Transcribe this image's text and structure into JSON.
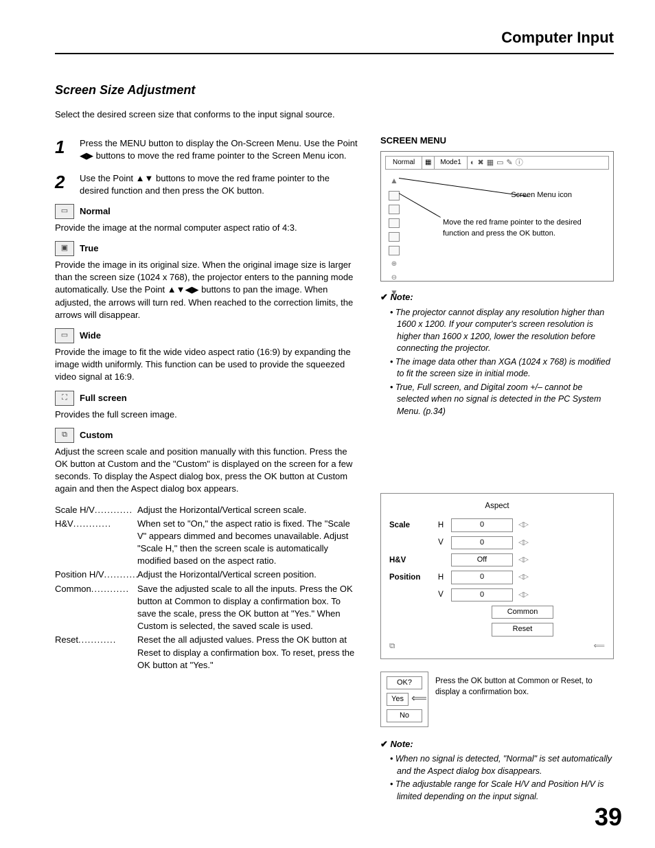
{
  "header": {
    "title": "Computer Input"
  },
  "section": {
    "title": "Screen Size Adjustment"
  },
  "intro": "Select the desired screen size that conforms to the input signal source.",
  "steps": {
    "s1n": "1",
    "s1": "Press the MENU button to display the On-Screen Menu. Use the Point ◀▶ buttons to move the red frame pointer to the Screen Menu icon.",
    "s2n": "2",
    "s2": "Use the Point ▲▼ buttons to move the red frame pointer to the desired function and then press the OK button."
  },
  "features": {
    "normal": {
      "label": "Normal",
      "desc": "Provide the image at the normal computer aspect ratio of 4:3."
    },
    "true": {
      "label": "True",
      "desc": "Provide the image in its original size. When the original image size is larger than the screen size (1024 x 768), the projector enters to the panning mode automatically. Use the Point ▲▼◀▶ buttons to pan the image. When adjusted, the arrows will turn red. When reached to the correction limits, the arrows will disappear."
    },
    "wide": {
      "label": "Wide",
      "desc": "Provide the image to fit the wide video aspect ratio (16:9) by expanding the image width uniformly. This function can be used to provide the squeezed video signal at 16:9."
    },
    "full": {
      "label": "Full screen",
      "desc": "Provides the full screen image."
    },
    "custom": {
      "label": "Custom",
      "desc": "Adjust the screen scale and position manually with this function. Press the OK button at Custom and the \"Custom\" is displayed on the screen for a few seconds. To display the Aspect dialog box, press the OK button at Custom again and then the Aspect dialog box appears."
    }
  },
  "defs": {
    "d1t": "Scale H/V",
    "d1": "Adjust the Horizontal/Vertical screen scale.",
    "d2t": "H&V",
    "d2": "When set to \"On,\" the aspect ratio is fixed. The \"Scale V\" appears dimmed and becomes unavailable. Adjust \"Scale H,\" then the screen scale is automatically modified based on the aspect ratio.",
    "d3t": "Position H/V",
    "d3": "Adjust the Horizontal/Vertical screen position.",
    "d4t": "Common",
    "d4": "Save the adjusted scale to all the inputs. Press the OK button at Common to display a confirmation box. To save the scale, press the OK button at \"Yes.\" When Custom is selected, the saved scale is used.",
    "d5t": "Reset",
    "d5": "Reset the all adjusted values. Press the OK button at Reset to display a confirmation box. To reset, press the OK button at \"Yes.\""
  },
  "menu": {
    "title": "SCREEN MENU",
    "tab": "Normal",
    "mode": "Mode1",
    "callout1": "Screen Menu icon",
    "callout2": "Move the red frame pointer to the desired function and press the OK button."
  },
  "note1": {
    "title": "Note:",
    "items": [
      "The projector cannot display any resolution higher than 1600 x 1200. If your computer's screen resolution is higher than 1600 x 1200, lower the resolution before connecting the projector.",
      "The image data other than XGA (1024 x 768) is modified to fit the screen size in initial mode.",
      "True, Full screen, and Digital zoom +/– cannot be selected when no signal is detected in the PC System Menu. (p.34)"
    ]
  },
  "aspect": {
    "title": "Aspect",
    "scale": "Scale",
    "h": "H",
    "v": "V",
    "hv": "H&V",
    "pos": "Position",
    "v0": "0",
    "off": "Off",
    "common": "Common",
    "reset": "Reset"
  },
  "okbox": {
    "q": "OK?",
    "yes": "Yes",
    "no": "No",
    "text": "Press the OK button at Common or Reset, to display a confirmation box."
  },
  "note2": {
    "title": "Note:",
    "items": [
      "When no signal is detected, \"Normal\" is set automatically and the Aspect dialog box disappears.",
      "The adjustable range for Scale H/V and Position H/V is limited depending on the input signal."
    ]
  },
  "pagenum": "39"
}
